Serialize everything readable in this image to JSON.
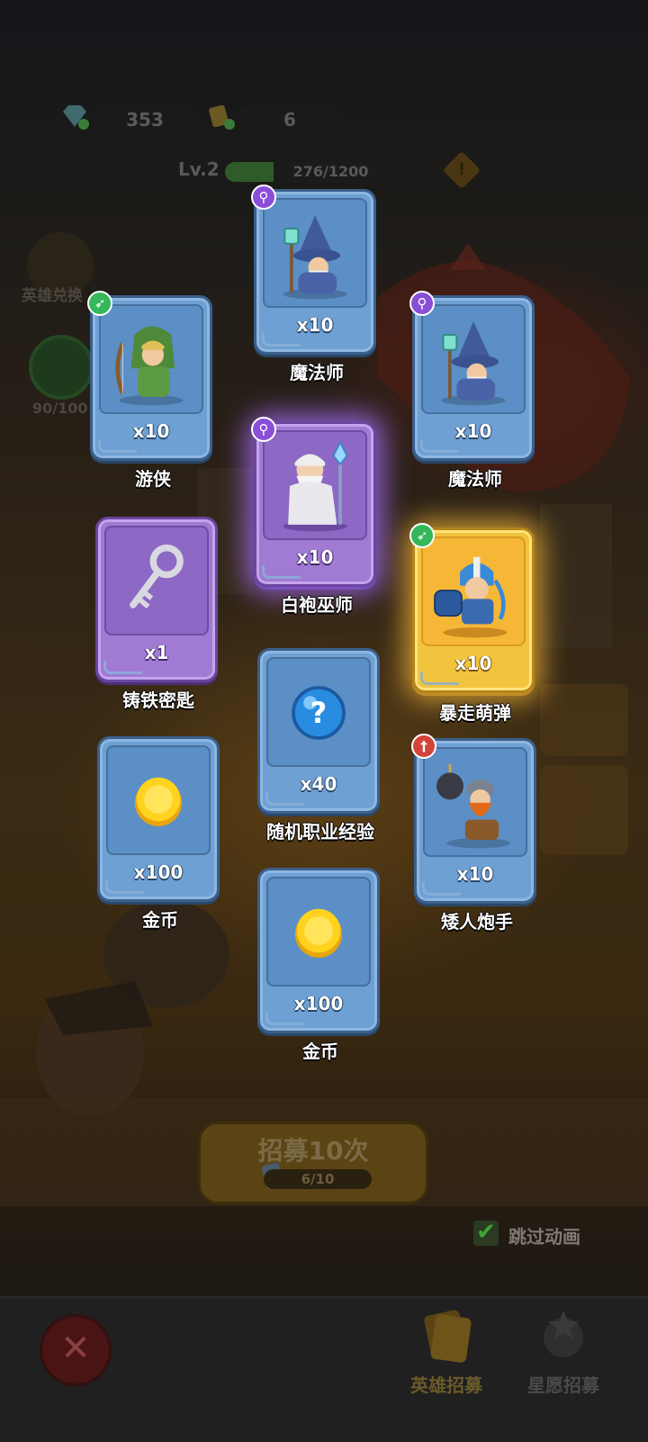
{
  "currency": {
    "gems": "353",
    "tickets": "6"
  },
  "level": {
    "label": "Lv.2",
    "progress_text": "276/1200",
    "progress": 0.23
  },
  "side": {
    "hero_exchange": "英雄兑换",
    "star_count": "90/100"
  },
  "cards": [
    {
      "name": "魔法师",
      "count": "x10",
      "rarity": "blue",
      "badge": "purple",
      "art": "wizard-blue"
    },
    {
      "name": "游侠",
      "count": "x10",
      "rarity": "blue",
      "badge": "green",
      "art": "ranger"
    },
    {
      "name": "魔法师",
      "count": "x10",
      "rarity": "blue",
      "badge": "purple",
      "art": "wizard-blue"
    },
    {
      "name": "白袍巫师",
      "count": "x10",
      "rarity": "purple",
      "badge": "purple",
      "art": "white-wizard"
    },
    {
      "name": "铸铁密匙",
      "count": "x1",
      "rarity": "purple",
      "badge": "",
      "art": "key"
    },
    {
      "name": "暴走萌弹",
      "count": "x10",
      "rarity": "gold",
      "badge": "green",
      "art": "gunner"
    },
    {
      "name": "随机职业经验",
      "count": "x40",
      "rarity": "blue",
      "badge": "",
      "art": "orb"
    },
    {
      "name": "金币",
      "count": "x100",
      "rarity": "blue",
      "badge": "",
      "art": "coin"
    },
    {
      "name": "矮人炮手",
      "count": "x10",
      "rarity": "blue",
      "badge": "red",
      "art": "dwarf"
    },
    {
      "name": "金币",
      "count": "x100",
      "rarity": "blue",
      "badge": "",
      "art": "coin"
    }
  ],
  "recruit": {
    "title": "招募10次",
    "progress": "6/10"
  },
  "skip_animation": {
    "label": "跳过动画",
    "checked": true
  },
  "bottom_tabs": {
    "hero_recruit": "英雄招募",
    "star_wish_recruit": "星愿招募"
  },
  "colors": {
    "blue_card": "#6ea0d3",
    "purple_card": "#a07ad3",
    "gold_card": "#f2c43e"
  }
}
